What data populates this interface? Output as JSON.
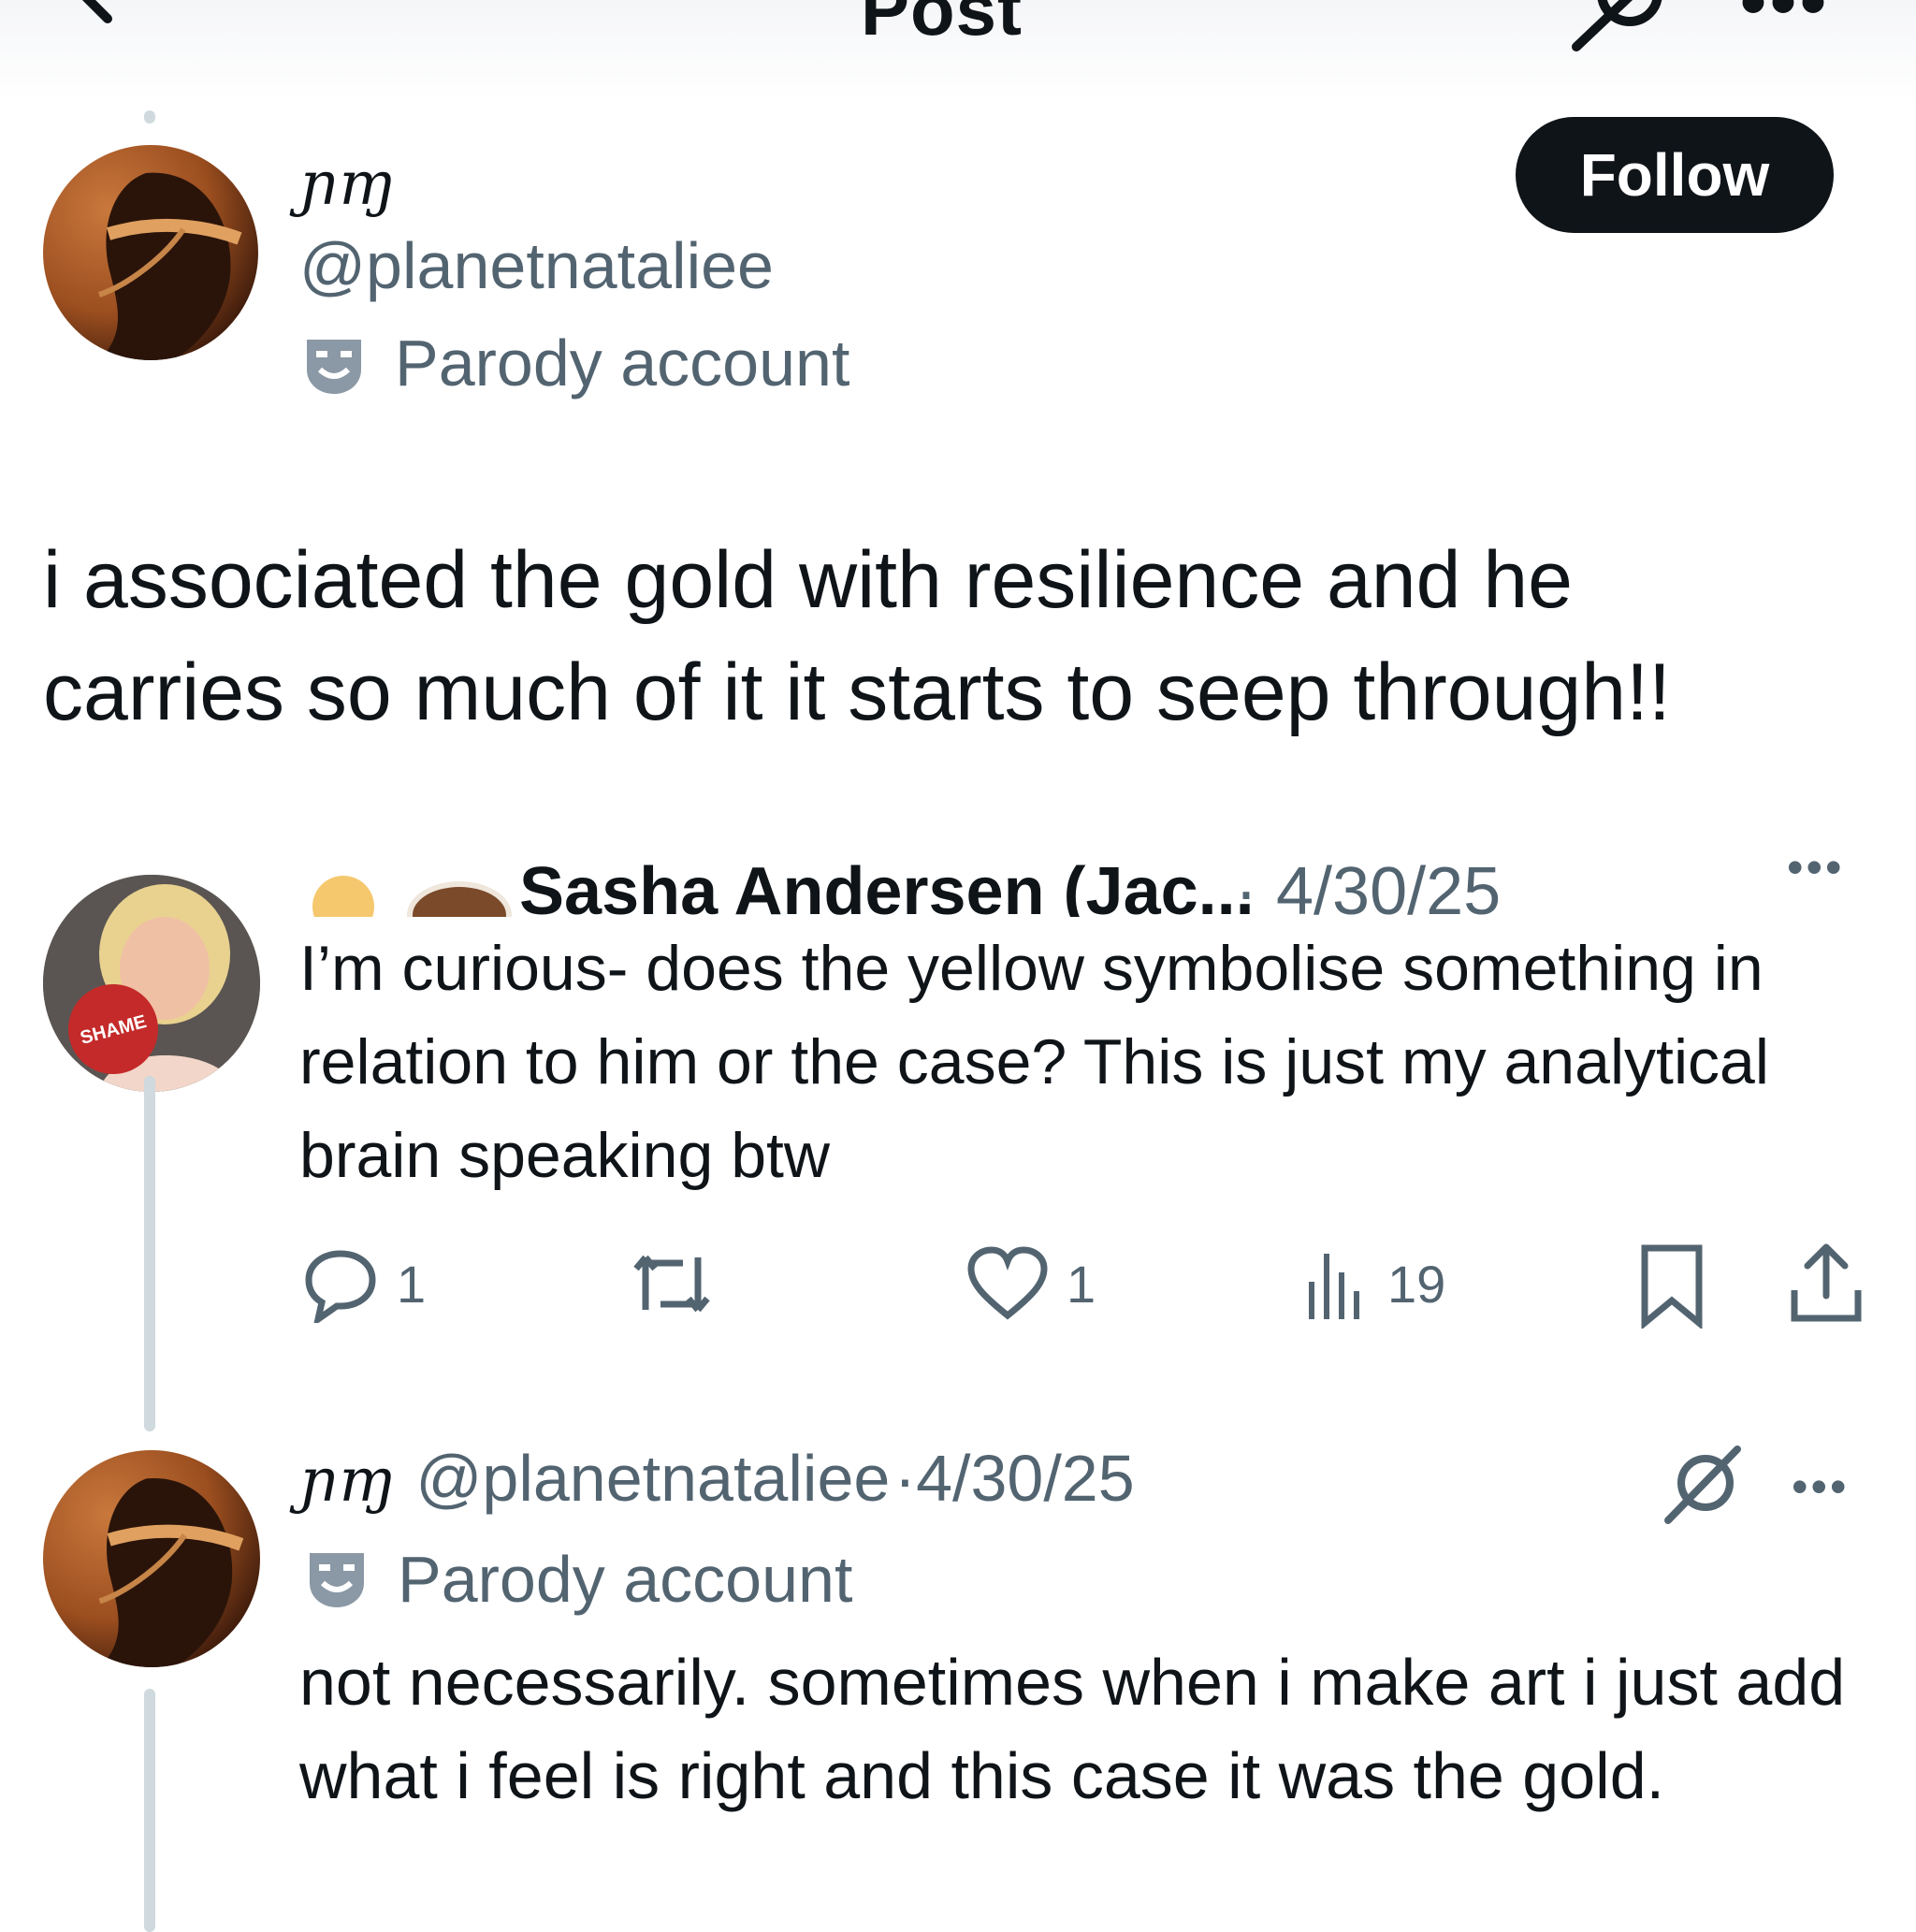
{
  "header": {
    "title": "Post"
  },
  "main_post": {
    "display_name": "ɲɱ",
    "handle": "@planetnataliee",
    "badge_text": "Parody account",
    "follow_label": "Follow",
    "text": "i associated the gold with resilience and he carries so much of it it starts to seep through!!"
  },
  "reply1": {
    "display_name": "Sasha Andersen (Jac...",
    "date": "· 4/30/25",
    "text": "I’m curious- does the yellow symbolise something in relation to him or the case? This is just my analytical brain speaking btw",
    "avatar_sign": "SHAME",
    "replies": "1",
    "likes": "1",
    "views": "19"
  },
  "reply2": {
    "display_name": "ɲɱ",
    "handle": "@planetnataliee",
    "date": "·4/30/25",
    "badge_text": "Parody account",
    "text": "not necessarily. sometimes when i make art i just add what i feel is right and this case it was the gold."
  },
  "colors": {
    "text": "#0f1419",
    "muted": "#536471",
    "thread_line": "#cfd9de",
    "follow_bg": "#0f1419"
  }
}
